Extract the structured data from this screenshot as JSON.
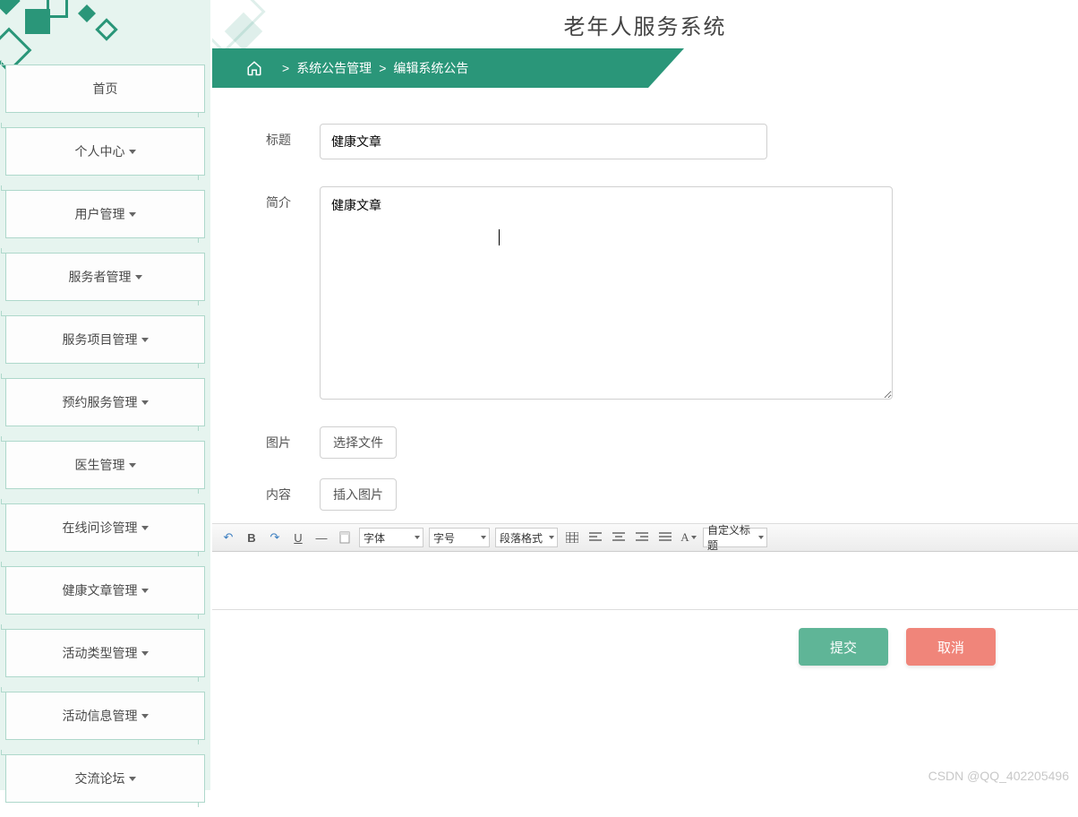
{
  "app_title": "老年人服务系统",
  "breadcrumb": {
    "sep": ">",
    "items": [
      "系统公告管理",
      "编辑系统公告"
    ]
  },
  "sidebar": {
    "items": [
      {
        "label": "首页",
        "has_children": false
      },
      {
        "label": "个人中心",
        "has_children": true
      },
      {
        "label": "用户管理",
        "has_children": true
      },
      {
        "label": "服务者管理",
        "has_children": true
      },
      {
        "label": "服务项目管理",
        "has_children": true
      },
      {
        "label": "预约服务管理",
        "has_children": true
      },
      {
        "label": "医生管理",
        "has_children": true
      },
      {
        "label": "在线问诊管理",
        "has_children": true
      },
      {
        "label": "健康文章管理",
        "has_children": true
      },
      {
        "label": "活动类型管理",
        "has_children": true
      },
      {
        "label": "活动信息管理",
        "has_children": true
      },
      {
        "label": "交流论坛",
        "has_children": true
      }
    ]
  },
  "form": {
    "title_label": "标题",
    "title_value": "健康文章",
    "intro_label": "简介",
    "intro_value": "健康文章",
    "image_label": "图片",
    "choose_file": "选择文件",
    "content_label": "内容",
    "insert_image": "插入图片"
  },
  "editor_toolbar": {
    "undo": "↶",
    "redo": "↷",
    "bold": "B",
    "underline": "U",
    "hr": "—",
    "font_family": "字体",
    "font_size": "字号",
    "paragraph": "段落格式",
    "custom_title": "自定义标题",
    "fontcolor": "A"
  },
  "actions": {
    "submit": "提交",
    "cancel": "取消"
  },
  "watermark": "CSDN @QQ_402205496"
}
